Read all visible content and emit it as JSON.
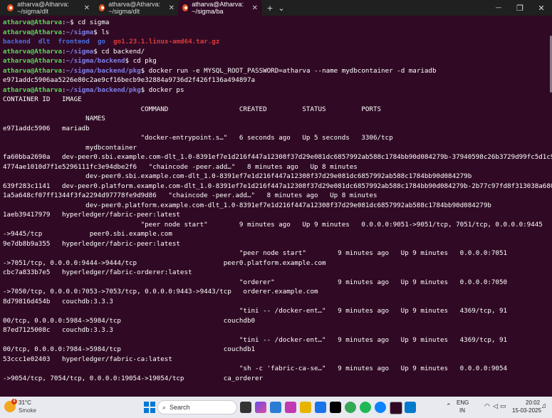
{
  "tabs": [
    {
      "title": "atharva@Atharva: ~/sigma/dlt",
      "close": "✕"
    },
    {
      "title": "atharva@Atharva: ~/sigma/dlt",
      "close": "✕"
    },
    {
      "title": "atharva@Atharva: ~/sigma/ba",
      "close": "✕"
    }
  ],
  "titlebar": {
    "new_tab": "+",
    "dropdown": "⌄",
    "minimize": "—",
    "maximize": "❐",
    "close": "✕"
  },
  "terminal": {
    "lines": [
      {
        "segments": [
          [
            "pg",
            "atharva@Atharva"
          ],
          [
            "w",
            ":"
          ],
          [
            "pp",
            "~"
          ],
          [
            "w",
            "$ cd sigma"
          ]
        ]
      },
      {
        "segments": [
          [
            "pg",
            "atharva@Atharva"
          ],
          [
            "w",
            ":"
          ],
          [
            "pp",
            "~/sigma"
          ],
          [
            "w",
            "$ ls"
          ]
        ]
      },
      {
        "segments": [
          [
            "bl",
            "backend"
          ],
          [
            "w",
            "  "
          ],
          [
            "bl",
            "dlt"
          ],
          [
            "w",
            "  "
          ],
          [
            "bl",
            "frontend"
          ],
          [
            "w",
            "  "
          ],
          [
            "bl",
            "go"
          ],
          [
            "w",
            "  "
          ],
          [
            "rd",
            "go1.23.1.linux-amd64.tar.gz"
          ]
        ]
      },
      {
        "segments": [
          [
            "pg",
            "atharva@Atharva"
          ],
          [
            "w",
            ":"
          ],
          [
            "pp",
            "~/sigma"
          ],
          [
            "w",
            "$ cd backend/"
          ]
        ]
      },
      {
        "segments": [
          [
            "pg",
            "atharva@Atharva"
          ],
          [
            "w",
            ":"
          ],
          [
            "pp",
            "~/sigma/backend"
          ],
          [
            "w",
            "$ cd pkg"
          ]
        ]
      },
      {
        "segments": [
          [
            "pg",
            "atharva@Atharva"
          ],
          [
            "w",
            ":"
          ],
          [
            "pp",
            "~/sigma/backend/pkg"
          ],
          [
            "w",
            "$ docker run -e MYSQL_ROOT_PASSWORD=atharva --name mydbcontainer -d mariadb"
          ]
        ]
      },
      {
        "segments": [
          [
            "w",
            "e971addc5906aa5226e80c2ae9cf16becb9e32884a9736d2f426f136a494897a"
          ]
        ]
      },
      {
        "segments": [
          [
            "pg",
            "atharva@Atharva"
          ],
          [
            "w",
            ":"
          ],
          [
            "pp",
            "~/sigma/backend/pkg"
          ],
          [
            "w",
            "$ docker ps"
          ]
        ]
      },
      {
        "segments": [
          [
            "w",
            "CONTAINER ID   IMAGE"
          ]
        ]
      },
      {
        "segments": [
          [
            "w",
            "                                   COMMAND                  CREATED         STATUS         PORTS"
          ]
        ]
      },
      {
        "segments": [
          [
            "w",
            "                     NAMES"
          ]
        ]
      },
      {
        "segments": [
          [
            "w",
            "e971addc5906   mariadb"
          ]
        ]
      },
      {
        "segments": [
          [
            "w",
            "                                   \"docker-entrypoint.s…\"   6 seconds ago   Up 5 seconds   3306/tcp"
          ]
        ]
      },
      {
        "segments": [
          [
            "w",
            "                     mydbcontainer"
          ]
        ]
      },
      {
        "segments": [
          [
            "w",
            "fa60bba2690a   dev-peer0.sbi.example.com-dlt_1.0-8391ef7e1d216f447a12308f37d29e081dc6857992ab588c1784bb90d084279b-37940598c26b3729d99fc5d1c9c6bf"
          ]
        ]
      },
      {
        "segments": [
          [
            "w",
            "4774ae1010d7f1e5296111fc3e94dbe2f6   \"chaincode -peer.add…\"   8 minutes ago   Up 8 minutes"
          ]
        ]
      },
      {
        "segments": [
          [
            "w",
            "                     dev-peer0.sbi.example.com-dlt_1.0-8391ef7e1d216f447a12308f37d29e081dc6857992ab588c1784bb90d084279b"
          ]
        ]
      },
      {
        "segments": [
          [
            "w",
            "639f283c1141   dev-peer0.platform.example.com-dlt_1.0-8391ef7e1d216f447a12308f37d29e081dc6857992ab588c1784bb90d084279b-2b77c97fd8f313038a6804fe1e"
          ]
        ]
      },
      {
        "segments": [
          [
            "w",
            "1a5a648cf07ff1344f3fa2294d97778fe9d9d86   \"chaincode -peer.add…\"   8 minutes ago   Up 8 minutes"
          ]
        ]
      },
      {
        "segments": [
          [
            "w",
            "                     dev-peer0.platform.example.com-dlt_1.0-8391ef7e1d216f447a12308f37d29e081dc6857992ab588c1784bb90d084279b"
          ]
        ]
      },
      {
        "segments": [
          [
            "w",
            "1aeb39417979   hyperledger/fabric-peer:latest"
          ]
        ]
      },
      {
        "segments": [
          [
            "w",
            "                                   \"peer node start\"        9 minutes ago   Up 9 minutes   0.0.0.0:9051->9051/tcp, 7051/tcp, 0.0.0.0:9445"
          ]
        ]
      },
      {
        "segments": [
          [
            "w",
            "->9445/tcp            peer0.sbi.example.com"
          ]
        ]
      },
      {
        "segments": [
          [
            "w",
            "9e7db8b9a355   hyperledger/fabric-peer:latest"
          ]
        ]
      },
      {
        "segments": [
          [
            "w",
            "                                                            \"peer node start\"        9 minutes ago   Up 9 minutes   0.0.0.0:7051"
          ]
        ]
      },
      {
        "segments": [
          [
            "w",
            "->7051/tcp, 0.0.0.0:9444->9444/tcp                      peer0.platform.example.com"
          ]
        ]
      },
      {
        "segments": [
          [
            "w",
            "cbc7a833b7e5   hyperledger/fabric-orderer:latest"
          ]
        ]
      },
      {
        "segments": [
          [
            "w",
            "                                                            \"orderer\"                9 minutes ago   Up 9 minutes   0.0.0.0:7050"
          ]
        ]
      },
      {
        "segments": [
          [
            "w",
            "->7050/tcp, 0.0.0.0:7053->7053/tcp, 0.0.0.0:9443->9443/tcp   orderer.example.com"
          ]
        ]
      },
      {
        "segments": [
          [
            "w",
            "8d79816d454b   couchdb:3.3.3"
          ]
        ]
      },
      {
        "segments": [
          [
            "w",
            "                                                            \"tini -- /docker-ent…\"   9 minutes ago   Up 9 minutes   4369/tcp, 91"
          ]
        ]
      },
      {
        "segments": [
          [
            "w",
            "00/tcp, 0.0.0.0:5984->5984/tcp                          couchdb0"
          ]
        ]
      },
      {
        "segments": [
          [
            "w",
            "87ed7125008c   couchdb:3.3.3"
          ]
        ]
      },
      {
        "segments": [
          [
            "w",
            "                                                            \"tini -- /docker-ent…\"   9 minutes ago   Up 9 minutes   4369/tcp, 91"
          ]
        ]
      },
      {
        "segments": [
          [
            "w",
            "00/tcp, 0.0.0.0:7984->5984/tcp                          couchdb1"
          ]
        ]
      },
      {
        "segments": [
          [
            "w",
            "53ccc1e02403   hyperledger/fabric-ca:latest"
          ]
        ]
      },
      {
        "segments": [
          [
            "w",
            "                                                            \"sh -c 'fabric-ca-se…\"   9 minutes ago   Up 9 minutes   0.0.0.0:9054"
          ]
        ]
      },
      {
        "segments": [
          [
            "w",
            "->9054/tcp, 7054/tcp, 0.0.0.0:19054->19054/tcp          ca_orderer"
          ]
        ]
      }
    ]
  },
  "taskbar": {
    "weather_temp": "31°C",
    "weather_desc": "Smoke",
    "search_placeholder": "Search",
    "lang1": "ENG",
    "lang2": "IN",
    "time": "20:02",
    "date": "15-03-2025",
    "badge": "4"
  },
  "colors": {
    "terminal_bg": "#300a24",
    "prompt_user": "#5bd35b",
    "prompt_path": "#7f7fe8",
    "dir": "#4a6fe0",
    "archive": "#e03a3a"
  }
}
